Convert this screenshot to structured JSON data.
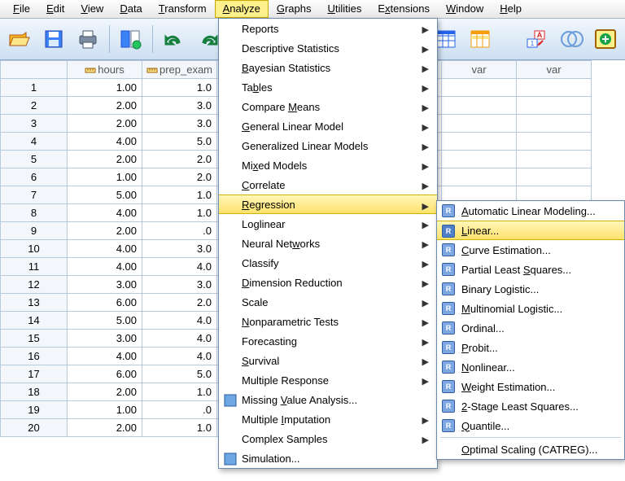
{
  "menubar": {
    "items": [
      {
        "label": "File",
        "u": "F"
      },
      {
        "label": "Edit",
        "u": "E"
      },
      {
        "label": "View",
        "u": "V"
      },
      {
        "label": "Data",
        "u": "D"
      },
      {
        "label": "Transform",
        "u": "T"
      },
      {
        "label": "Analyze",
        "u": "A",
        "active": true
      },
      {
        "label": "Graphs",
        "u": "G"
      },
      {
        "label": "Utilities",
        "u": "U"
      },
      {
        "label": "Extensions",
        "u": "x"
      },
      {
        "label": "Window",
        "u": "W"
      },
      {
        "label": "Help",
        "u": "H"
      }
    ]
  },
  "columns": [
    "hours",
    "prep_exam",
    "",
    "",
    "var",
    "var",
    "var"
  ],
  "rows": [
    {
      "n": 1,
      "hours": "1.00",
      "prep": "1.0"
    },
    {
      "n": 2,
      "hours": "2.00",
      "prep": "3.0"
    },
    {
      "n": 3,
      "hours": "2.00",
      "prep": "3.0"
    },
    {
      "n": 4,
      "hours": "4.00",
      "prep": "5.0"
    },
    {
      "n": 5,
      "hours": "2.00",
      "prep": "2.0"
    },
    {
      "n": 6,
      "hours": "1.00",
      "prep": "2.0"
    },
    {
      "n": 7,
      "hours": "5.00",
      "prep": "1.0"
    },
    {
      "n": 8,
      "hours": "4.00",
      "prep": "1.0"
    },
    {
      "n": 9,
      "hours": "2.00",
      "prep": ".0"
    },
    {
      "n": 10,
      "hours": "4.00",
      "prep": "3.0"
    },
    {
      "n": 11,
      "hours": "4.00",
      "prep": "4.0"
    },
    {
      "n": 12,
      "hours": "3.00",
      "prep": "3.0"
    },
    {
      "n": 13,
      "hours": "6.00",
      "prep": "2.0"
    },
    {
      "n": 14,
      "hours": "5.00",
      "prep": "4.0"
    },
    {
      "n": 15,
      "hours": "3.00",
      "prep": "4.0"
    },
    {
      "n": 16,
      "hours": "4.00",
      "prep": "4.0"
    },
    {
      "n": 17,
      "hours": "6.00",
      "prep": "5.0"
    },
    {
      "n": 18,
      "hours": "2.00",
      "prep": "1.0"
    },
    {
      "n": 19,
      "hours": "1.00",
      "prep": ".0"
    },
    {
      "n": 20,
      "hours": "2.00",
      "prep": "1.0"
    }
  ],
  "analyze_menu": [
    {
      "label": "Reports",
      "u": "P",
      "sub": true
    },
    {
      "label": "Descriptive Statistics",
      "u": "E",
      "sub": true
    },
    {
      "label": "Bayesian Statistics",
      "u": "B",
      "sub": true
    },
    {
      "label": "Tables",
      "u": "b",
      "sub": true
    },
    {
      "label": "Compare Means",
      "u": "M",
      "sub": true
    },
    {
      "label": "General Linear Model",
      "u": "G",
      "sub": true
    },
    {
      "label": "Generalized Linear Models",
      "u": "Z",
      "sub": true
    },
    {
      "label": "Mixed Models",
      "u": "x",
      "sub": true
    },
    {
      "label": "Correlate",
      "u": "C",
      "sub": true
    },
    {
      "label": "Regression",
      "u": "R",
      "sub": true,
      "hi": true
    },
    {
      "label": "Loglinear",
      "u": "O",
      "sub": true
    },
    {
      "label": "Neural Networks",
      "u": "w",
      "sub": true
    },
    {
      "label": "Classify",
      "u": "F",
      "sub": true
    },
    {
      "label": "Dimension Reduction",
      "u": "D",
      "sub": true
    },
    {
      "label": "Scale",
      "u": "A",
      "sub": true
    },
    {
      "label": "Nonparametric Tests",
      "u": "N",
      "sub": true
    },
    {
      "label": "Forecasting",
      "u": "T",
      "sub": true
    },
    {
      "label": "Survival",
      "u": "S",
      "sub": true
    },
    {
      "label": "Multiple Response",
      "u": "U",
      "sub": true
    },
    {
      "label": "Missing Value Analysis...",
      "u": "V",
      "sub": false,
      "icon": true
    },
    {
      "label": "Multiple Imputation",
      "u": "I",
      "sub": true
    },
    {
      "label": "Complex Samples",
      "u": "L",
      "sub": true
    },
    {
      "label": "Simulation...",
      "u": "",
      "sub": false,
      "icon": true
    }
  ],
  "regression_menu": [
    {
      "label": "Automatic Linear Modeling...",
      "u": "A"
    },
    {
      "label": "Linear...",
      "u": "L",
      "hi": true
    },
    {
      "label": "Curve Estimation...",
      "u": "C"
    },
    {
      "label": "Partial Least Squares...",
      "u": "S"
    },
    {
      "label": "Binary Logistic...",
      "u": "G"
    },
    {
      "label": "Multinomial Logistic...",
      "u": "M"
    },
    {
      "label": "Ordinal...",
      "u": "D"
    },
    {
      "label": "Probit...",
      "u": "P"
    },
    {
      "label": "Nonlinear...",
      "u": "N"
    },
    {
      "label": "Weight Estimation...",
      "u": "W"
    },
    {
      "label": "2-Stage Least Squares...",
      "u": "2"
    },
    {
      "label": "Quantile...",
      "u": "Q"
    },
    {
      "sep": true
    },
    {
      "label": "Optimal Scaling (CATREG)...",
      "u": "O",
      "noicon": true
    }
  ]
}
